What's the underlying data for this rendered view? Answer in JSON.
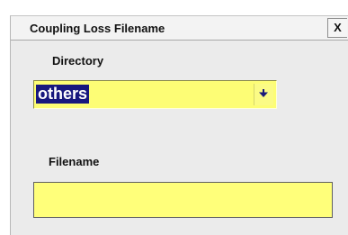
{
  "dialog": {
    "title": "Coupling Loss Filename",
    "close_label": "X"
  },
  "directory": {
    "label": "Directory",
    "selected_value": "others",
    "dropdown_icon": "chevron-down-icon"
  },
  "filename": {
    "label": "Filename",
    "value": ""
  },
  "colors": {
    "field_background": "#ffff7a",
    "selection_highlight": "#17177e",
    "dialog_background": "#ebebeb"
  }
}
